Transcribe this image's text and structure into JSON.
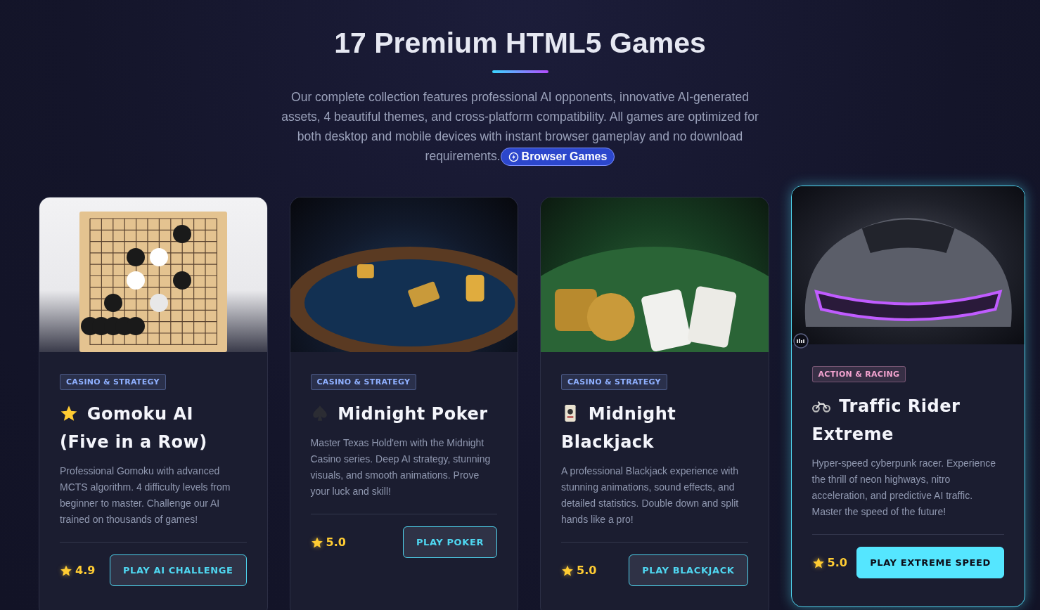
{
  "header": {
    "title": "17 Premium HTML5 Games",
    "description": "Our complete collection features professional AI opponents, innovative AI-generated assets, 4 beautiful themes, and cross-platform compatibility. All games are optimized for both desktop and mobile devices with instant browser gameplay and no download requirements.",
    "badge": "Browser Games"
  },
  "cards": [
    {
      "kind": "board",
      "highlighted": false,
      "tag": {
        "label": "CASINO & STRATEGY",
        "color": "#8fb0ff"
      },
      "title": "Gomoku AI (Five in a Row)",
      "description": "Professional Gomoku with advanced MCTS algorithm. 4 difficulty levels from beginner to master. Challenge our AI trained on thousands of games!",
      "rating": "4.9",
      "button": "PLAY AI CHALLENGE"
    },
    {
      "kind": "poker",
      "highlighted": false,
      "tag": {
        "label": "CASINO & STRATEGY",
        "color": "#8fb0ff"
      },
      "title": "Midnight Poker",
      "description": "Master Texas Hold'em with the Midnight Casino series. Deep AI strategy, stunning visuals, and smooth animations. Prove your luck and skill!",
      "rating": "5.0",
      "button": "PLAY POKER"
    },
    {
      "kind": "blackjack",
      "highlighted": false,
      "tag": {
        "label": "CASINO & STRATEGY",
        "color": "#8fb0ff"
      },
      "title": "Midnight Blackjack",
      "description": "A professional Blackjack experience with stunning animations, sound effects, and detailed statistics. Double down and split hands like a pro!",
      "rating": "5.0",
      "button": "PLAY BLACKJACK"
    },
    {
      "kind": "car",
      "highlighted": true,
      "tag": {
        "label": "ACTION & RACING",
        "color": "#f3a3d0"
      },
      "title": "Traffic Rider Extreme",
      "description": "Hyper-speed cyberpunk racer. Experience the thrill of neon highways, nitro acceleration, and predictive AI traffic. Master the speed of the future!",
      "rating": "5.0",
      "button": "PLAY EXTREME SPEED"
    }
  ]
}
